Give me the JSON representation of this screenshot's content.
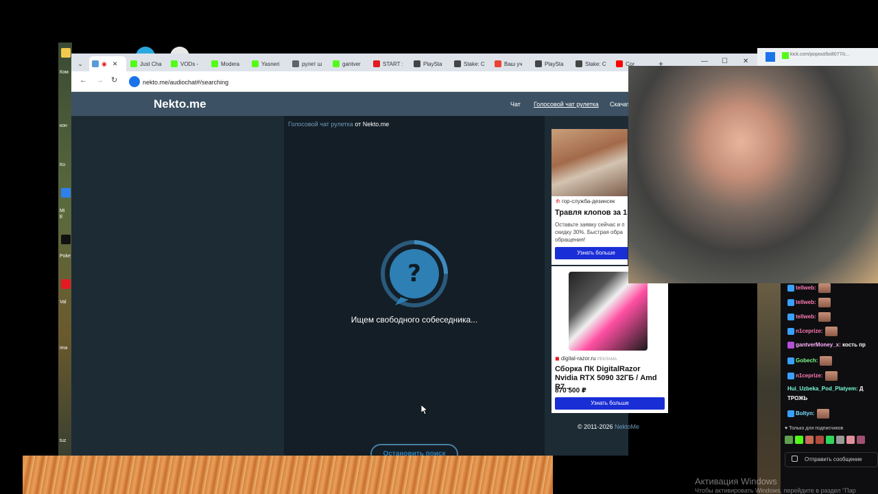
{
  "tabs": [
    {
      "label": "Just Cha",
      "color": "#53fc18"
    },
    {
      "label": "VODs -",
      "color": "#53fc18"
    },
    {
      "label": "Modera",
      "color": "#53fc18"
    },
    {
      "label": "Yasneri",
      "color": "#53fc18"
    },
    {
      "label": "рулет ш",
      "color": "#5f6368"
    },
    {
      "label": "gantver",
      "color": "#53fc18"
    },
    {
      "label": "START :",
      "color": "#e31b23"
    },
    {
      "label": "PlaySta",
      "color": "#444"
    },
    {
      "label": "Stake: C",
      "color": "#444"
    },
    {
      "label": "Ваш уч",
      "color": "#ea4335"
    },
    {
      "label": "PlaySta",
      "color": "#444"
    },
    {
      "label": "Stake: C",
      "color": "#444"
    },
    {
      "label": "Cor",
      "color": "#ff0000"
    }
  ],
  "address": {
    "url": "nekto.me/audiochat#/searching"
  },
  "popout_url": "kick.com/popout/bolt077/c...",
  "site": {
    "logo": "Nekto.me",
    "nav": [
      "Чат",
      "Голосовой чат рулетка",
      "Скачат"
    ]
  },
  "main": {
    "title_link": "Голосовой чат рулетка",
    "title_rest": " от Nekto.me",
    "spinner_symbol": "?",
    "status": "Ищем свободного собеседника...",
    "stop_button": "Остановить поиск"
  },
  "ad1": {
    "source": "гор-служба-дезинсек",
    "title": "Травля клопов за 1",
    "text": "Оставьте заявку сейчас и п скидку 30%. Быстрая обра обращения!",
    "button": "Узнать больше"
  },
  "ad2": {
    "source": "digital-razor.ru",
    "tag": "РЕКЛАМА",
    "title": "Сборка ПК DigitalRazor Nvidia RTX 5090 32ГБ / Amd R7...",
    "price": "870 500 ₽",
    "button": "Узнать больше"
  },
  "footer": {
    "copyright": "© 2011-2026 ",
    "link": "NektoMe"
  },
  "chat": {
    "messages": [
      {
        "user": "tellweb:",
        "color": "#ff7ab4",
        "badge": "#3aa0ff",
        "text": "",
        "emote": true
      },
      {
        "user": "tellweb:",
        "color": "#ff7ab4",
        "badge": "#3aa0ff",
        "text": "",
        "emote": true
      },
      {
        "user": "tellweb:",
        "color": "#ff7ab4",
        "badge": "#3aa0ff",
        "text": "",
        "emote": true
      },
      {
        "user": "n1ceprize:",
        "color": "#ff7ab4",
        "badge": "#3aa0ff",
        "text": "",
        "emote": true
      },
      {
        "user": "gantverMoney_x:",
        "color": "#ffb3ff",
        "badge": "#b44fd8",
        "text": " кость пр",
        "emote": false
      },
      {
        "user": "Gobech:",
        "color": "#7cff8a",
        "badge": "#3aa0ff",
        "text": "",
        "emote": true
      },
      {
        "user": "n1ceprize:",
        "color": "#ff7ab4",
        "badge": "#3aa0ff",
        "text": "",
        "emote": true
      },
      {
        "user": "Hui_Uzbeka_Pod_Platyem:",
        "color": "#7cffd9",
        "badge": "",
        "text": " Д",
        "emote": false
      },
      {
        "user": "",
        "color": "#ffffff",
        "badge": "",
        "text": "ТРОЖЬ",
        "emote": false
      },
      {
        "user": "Boltyn:",
        "color": "#7ce0ff",
        "badge": "#3aa0ff",
        "text": "",
        "emote": true
      }
    ],
    "sub_only": "♥ Только для подписчиков",
    "send_placeholder": "Отправить сообщение"
  },
  "windows_activation": {
    "title": "Активация Windows",
    "text": "Чтобы активировать Windows, перейдите в раздел \"Пар"
  },
  "desktop_labels": [
    "Ком",
    "кон",
    "Ко",
    "Mi",
    "E",
    "Poke",
    "Val",
    "ima",
    "tuz"
  ]
}
